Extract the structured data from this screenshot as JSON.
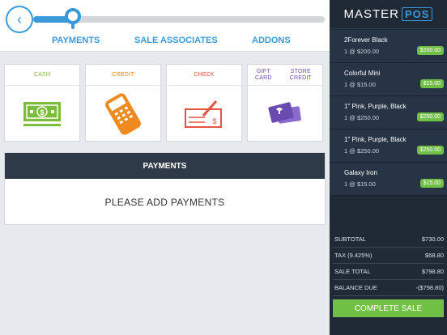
{
  "header": {
    "tabs": [
      {
        "label": "PAYMENTS"
      },
      {
        "label": "SALE ASSOCIATES"
      },
      {
        "label": "ADDONS"
      }
    ]
  },
  "payment_methods": [
    {
      "label": "CASH",
      "color": "#7dbd3c",
      "icon": "cash-icon"
    },
    {
      "label": "CREDIT",
      "color": "#f08a1e",
      "icon": "credit-card-terminal-icon"
    },
    {
      "label": "CHECK",
      "color": "#e8533f",
      "icon": "check-icon"
    },
    {
      "label": "GIFT CARD",
      "label2": "STORE CREDIT",
      "color": "#6a4cb1",
      "icon": "gift-card-icon"
    }
  ],
  "payments": {
    "title": "PAYMENTS",
    "empty_message": "PLEASE ADD PAYMENTS"
  },
  "brand": {
    "part1": "MASTER",
    "part2": "POS"
  },
  "cart": {
    "items": [
      {
        "name": "2Forever Black",
        "qty": "1 @ $200.00",
        "price": "$200.00"
      },
      {
        "name": "Colorful Mini",
        "qty": "1 @ $15.00",
        "price": "$15.00"
      },
      {
        "name": "1\" Pink, Purple, Black",
        "qty": "1 @ $250.00",
        "price": "$250.00"
      },
      {
        "name": "1\" Pink, Purple, Black",
        "qty": "1 @ $250.00",
        "price": "$250.00"
      },
      {
        "name": "Galaxy Iron",
        "qty": "1 @ $15.00",
        "price": "$15.00"
      }
    ]
  },
  "summary": {
    "subtotal_label": "SUBTOTAL",
    "subtotal": "$730.00",
    "tax_label": "TAX (9.425%)",
    "tax": "$68.80",
    "sale_total_label": "SALE TOTAL",
    "sale_total": "$798.80",
    "balance_label": "BALANCE DUE",
    "balance": "-($798.80)"
  },
  "actions": {
    "complete_label": "COMPLETE SALE"
  },
  "colors": {
    "accent": "#3a9ad9",
    "sidebar": "#1f2a36",
    "success": "#71c046"
  }
}
